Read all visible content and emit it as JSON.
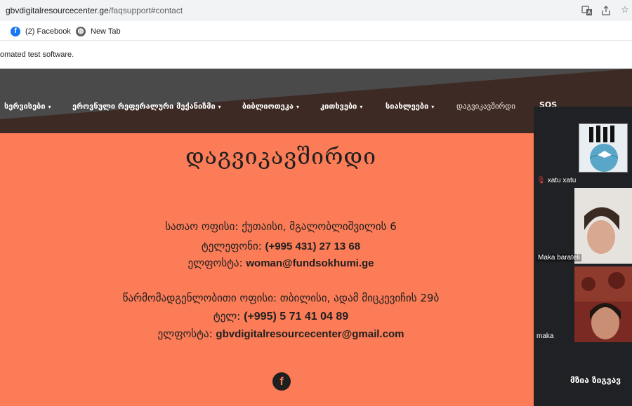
{
  "browser": {
    "url_host": "gbvdigitalresourcecenter.ge",
    "url_path": "/faqsupport#contact",
    "bookmarks": [
      {
        "label": "(2) Facebook",
        "icon": "facebook-icon"
      },
      {
        "label": "New Tab",
        "icon": "globe-icon"
      }
    ],
    "infobar_text": "omated test software."
  },
  "nav": {
    "items": [
      {
        "label": "სერვისები",
        "dropdown": true
      },
      {
        "label": "ეროვნული რეფერალური მექანიზმი",
        "dropdown": true
      },
      {
        "label": "ბიბლიოთეკა",
        "dropdown": true
      },
      {
        "label": "კითხვები",
        "dropdown": true
      },
      {
        "label": "სიახლეები",
        "dropdown": true
      },
      {
        "label": "დაგვიკავშირდი",
        "dropdown": false
      },
      {
        "label": "SOS",
        "dropdown": false
      }
    ],
    "caret": "▾"
  },
  "contact": {
    "title": "დაგვიკავშირდი",
    "head_office": "სათაო ოფისი: ქუთაისი, მგალობლიშვილის 6",
    "phone_label": "ტელეფონი: ",
    "phone_value": "(+995 431) 27 13 68",
    "email_label": "ელფოსტა: ",
    "email_value": "woman@fundsokhumi.ge",
    "rep_office": "წარმომადგენლობითი ოფისი: თბილისი, ადამ მიცკევიჩის 29ბ",
    "rep_phone_label": "ტელ: ",
    "rep_phone_value": "(+995) 5 71 41 04 89",
    "rep_email_label": "ელფოსტა: ",
    "rep_email_value": "gbvdigitalresourcecenter@gmail.com"
  },
  "meeting": {
    "participants": [
      {
        "name": "xatu xatu",
        "muted": true
      },
      {
        "name": "Maka barateli",
        "muted": false
      },
      {
        "name": "maka",
        "muted": false
      }
    ],
    "self_name": "მზია ზიგვავ"
  },
  "colors": {
    "content_bg": "#fb7c57",
    "header_dark": "#3e2a24",
    "header_gray": "#4a4a4a"
  }
}
